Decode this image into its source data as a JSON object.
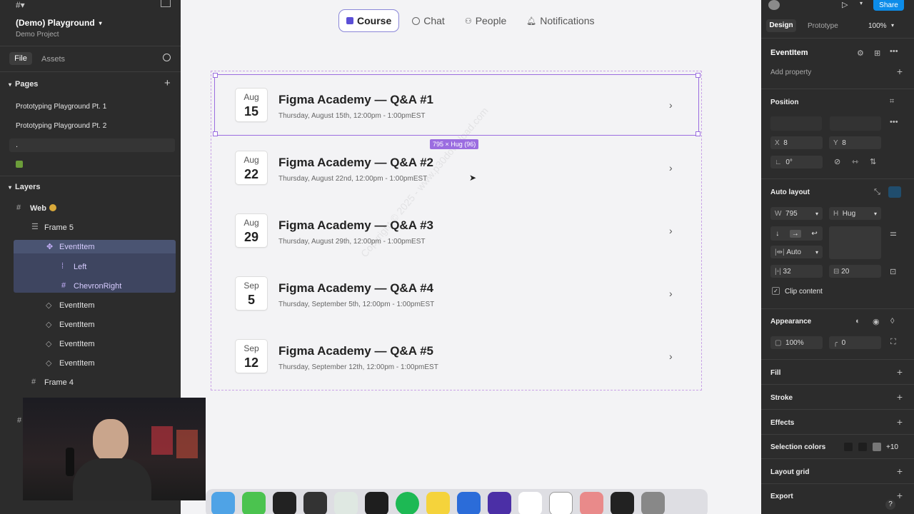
{
  "left": {
    "project_name": "(Demo) Playground",
    "project_sub": "Demo Project",
    "tabs": [
      "File",
      "Assets"
    ],
    "pages_title": "Pages",
    "pages": [
      "Prototyping Playground Pt. 1",
      "Prototyping Playground Pt. 2",
      ".",
      ""
    ],
    "layers_title": "Layers",
    "layers": [
      {
        "name": "Web",
        "indent": 0,
        "type": "frame"
      },
      {
        "name": "Frame 5",
        "indent": 1,
        "type": "frame"
      },
      {
        "name": "EventItem",
        "indent": 2,
        "type": "component"
      },
      {
        "name": "Left",
        "indent": 3,
        "type": "frame"
      },
      {
        "name": "ChevronRight",
        "indent": 3,
        "type": "frame"
      },
      {
        "name": "EventItem",
        "indent": 2,
        "type": "instance"
      },
      {
        "name": "EventItem",
        "indent": 2,
        "type": "instance"
      },
      {
        "name": "EventItem",
        "indent": 2,
        "type": "instance"
      },
      {
        "name": "EventItem",
        "indent": 2,
        "type": "instance"
      },
      {
        "name": "Frame 4",
        "indent": 1,
        "type": "frame"
      }
    ]
  },
  "canvas": {
    "nav": [
      {
        "label": "Course",
        "icon": "calendar-icon",
        "active": true
      },
      {
        "label": "Chat",
        "icon": "chat-icon",
        "active": false
      },
      {
        "label": "People",
        "icon": "people-icon",
        "active": false
      },
      {
        "label": "Notifications",
        "icon": "bell-icon",
        "active": false
      }
    ],
    "events": [
      {
        "month": "Aug",
        "day": "15",
        "title": "Figma Academy — Q&A #1",
        "subtitle": "Thursday, August 15th, 12:00pm - 1:00pmEST"
      },
      {
        "month": "Aug",
        "day": "22",
        "title": "Figma Academy — Q&A #2",
        "subtitle": "Thursday, August 22nd, 12:00pm - 1:00pmEST"
      },
      {
        "month": "Aug",
        "day": "29",
        "title": "Figma Academy — Q&A #3",
        "subtitle": "Thursday, August 29th, 12:00pm - 1:00pmEST"
      },
      {
        "month": "Sep",
        "day": "5",
        "title": "Figma Academy — Q&A #4",
        "subtitle": "Thursday, September 5th, 12:00pm - 1:00pmEST"
      },
      {
        "month": "Sep",
        "day": "12",
        "title": "Figma Academy — Q&A #5",
        "subtitle": "Thursday, September 12th, 12:00pm - 1:00pmEST"
      }
    ],
    "dimension_label": "795 × Hug (96)",
    "watermark": "Copyright © 2025 - www.p30download.com"
  },
  "right": {
    "share_label": "Share",
    "tabs": [
      "Design",
      "Prototype"
    ],
    "zoom": "100%",
    "component_name": "EventItem",
    "add_property": "Add property",
    "position_title": "Position",
    "x": "8",
    "y": "8",
    "x_label": "X",
    "y_label": "Y",
    "rotation": "0°",
    "autolayout_title": "Auto layout",
    "w_label": "W",
    "width": "795",
    "h_label": "H",
    "height": "Hug",
    "gap_mode": "Auto",
    "padding": "32",
    "spacing": "20",
    "clip_content": "Clip content",
    "appearance_title": "Appearance",
    "opacity": "100%",
    "radius": "0",
    "sections": [
      "Fill",
      "Stroke",
      "Effects",
      "Selection colors",
      "Layout grid",
      "Export"
    ],
    "selection_colors_more": "+10",
    "help": "?"
  },
  "colors": {
    "selection": "#9b6de0",
    "share_blue": "#0c8ce9",
    "panel_bg": "#2c2c2c"
  }
}
